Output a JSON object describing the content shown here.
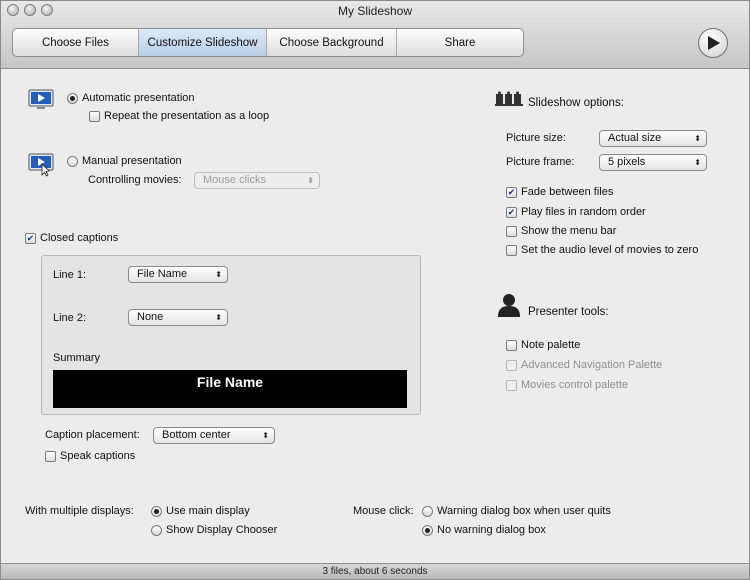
{
  "window": {
    "title": "My Slideshow"
  },
  "tabs": [
    {
      "label": "Choose Files"
    },
    {
      "label": "Customize Slideshow"
    },
    {
      "label": "Choose Background"
    },
    {
      "label": "Share"
    }
  ],
  "presentation": {
    "automatic_label": "Automatic presentation",
    "loop_label": "Repeat the presentation as a loop",
    "manual_label": "Manual presentation",
    "controlling_movies_label": "Controlling movies:",
    "controlling_movies_value": "Mouse clicks"
  },
  "captions": {
    "closed_captions_label": "Closed captions",
    "line1_label": "Line 1:",
    "line1_value": "File Name",
    "line2_label": "Line 2:",
    "line2_value": "None",
    "summary_label": "Summary",
    "summary_preview": "File Name",
    "placement_label": "Caption placement:",
    "placement_value": "Bottom center",
    "speak_label": "Speak captions"
  },
  "slideshow_options": {
    "heading": "Slideshow options:",
    "picture_size_label": "Picture size:",
    "picture_size_value": "Actual size",
    "picture_frame_label": "Picture frame:",
    "picture_frame_value": "5 pixels",
    "fade_label": "Fade between files",
    "random_label": "Play files in random order",
    "menu_bar_label": "Show the menu bar",
    "audio_zero_label": "Set the audio level of movies to zero"
  },
  "presenter_tools": {
    "heading": "Presenter tools:",
    "note_label": "Note palette",
    "advanced_nav_label": "Advanced Navigation Palette",
    "movies_control_label": "Movies control palette"
  },
  "displays": {
    "label": "With multiple displays:",
    "main_display": "Use main display",
    "display_chooser": "Show Display Chooser"
  },
  "mouse_click": {
    "label": "Mouse click:",
    "warning": "Warning dialog box when user quits",
    "no_warning": "No warning dialog box"
  },
  "status_bar": {
    "text": "3 files, about 6 seconds"
  },
  "colors": {
    "active_tab": "#c5daf0",
    "summary_bg": "#000000",
    "monitor_blue": "#1f5fbf"
  }
}
